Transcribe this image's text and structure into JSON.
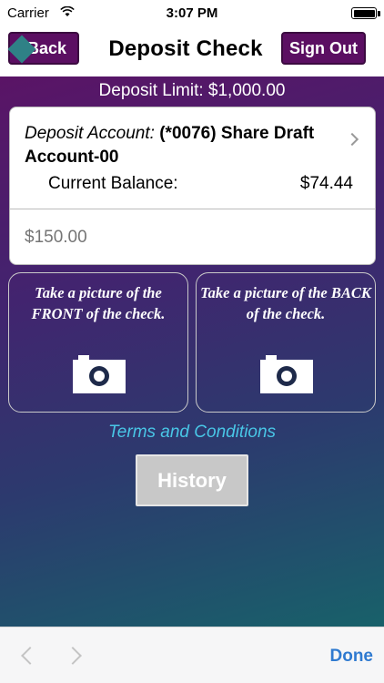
{
  "status_bar": {
    "carrier": "Carrier",
    "time": "3:07 PM",
    "wifi_icon": "wifi-icon",
    "battery_icon": "battery-icon"
  },
  "nav": {
    "back_label": "Back",
    "title": "Deposit Check",
    "signout_label": "Sign Out"
  },
  "deposit_limit": "Deposit Limit: $1,000.00",
  "account": {
    "label": "Deposit Account:",
    "name_line1": "(*0076) Share Draft",
    "name_line2": "Account-00",
    "balance_label": "Current Balance:",
    "balance_value": "$74.44",
    "chevron_icon": "chevron-right-icon"
  },
  "amount": {
    "value": "",
    "placeholder": "$150.00"
  },
  "photos": {
    "front_text": "Take a picture of the FRONT of the check.",
    "back_text": "Take a picture of the BACK of the check.",
    "camera_icon": "camera-icon"
  },
  "terms_link": "Terms and Conditions",
  "history_label": "History",
  "toolbar": {
    "prev_icon": "chevron-left-icon",
    "next_icon": "chevron-right-icon",
    "done_label": "Done"
  },
  "colors": {
    "button_purple": "#5b0f62",
    "link_cyan": "#49c6e6",
    "done_blue": "#2f7ad0",
    "gradient_top": "#5a1466",
    "gradient_bottom": "#18616a"
  }
}
